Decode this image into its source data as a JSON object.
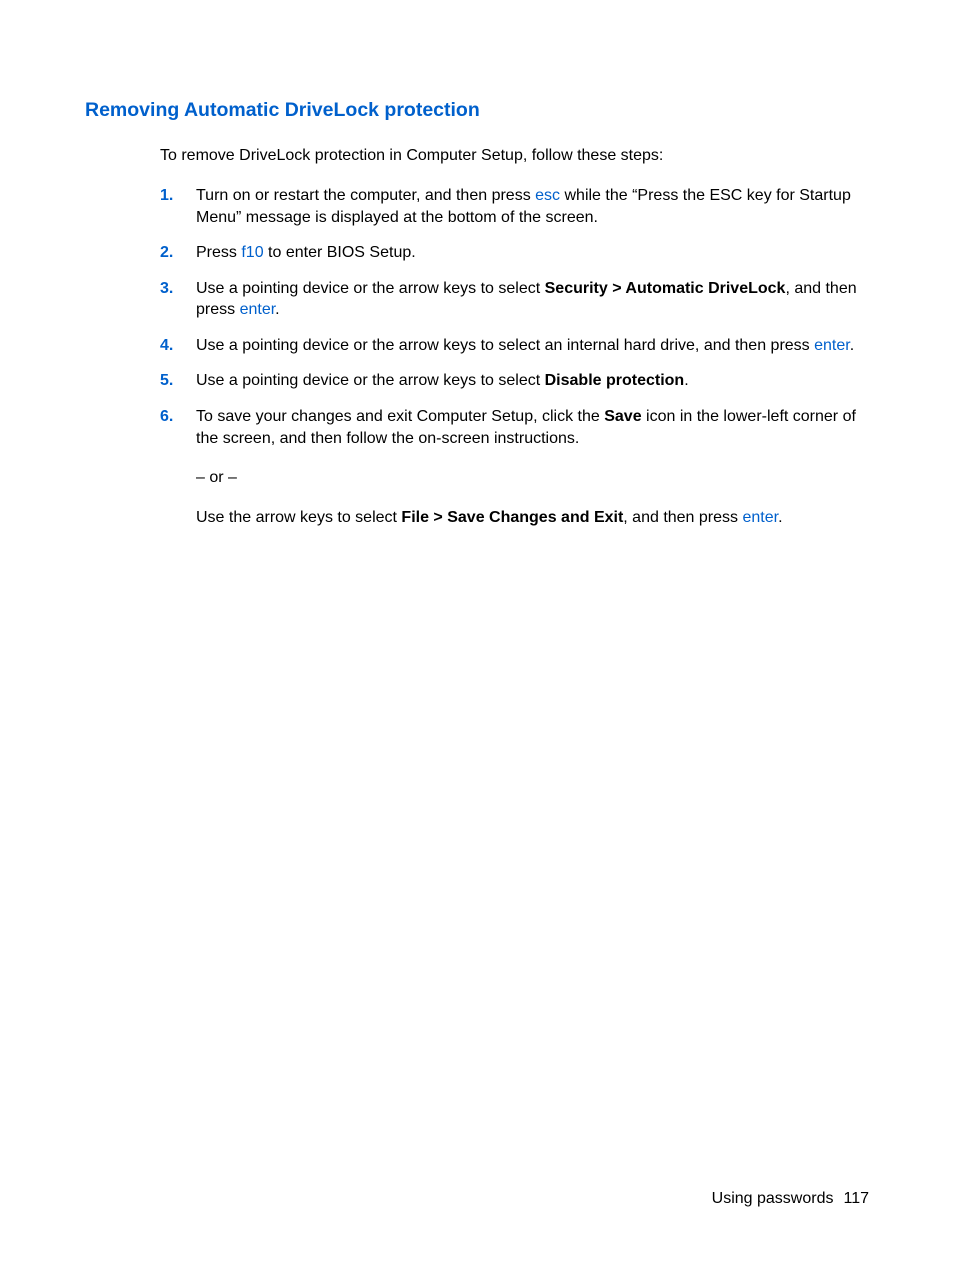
{
  "heading": "Removing Automatic DriveLock protection",
  "intro": "To remove DriveLock protection in Computer Setup, follow these steps:",
  "steps": {
    "s1": {
      "num": "1.",
      "t1": "Turn on or restart the computer, and then press ",
      "k1": "esc",
      "t2": " while the “Press the ESC key for Startup Menu” message is displayed at the bottom of the screen."
    },
    "s2": {
      "num": "2.",
      "t1": "Press ",
      "k1": "f10",
      "t2": " to enter BIOS Setup."
    },
    "s3": {
      "num": "3.",
      "t1": "Use a pointing device or the arrow keys to select ",
      "b1": "Security > Automatic DriveLock",
      "t2": ", and then press ",
      "k1": "enter",
      "t3": "."
    },
    "s4": {
      "num": "4.",
      "t1": "Use a pointing device or the arrow keys to select an internal hard drive, and then press ",
      "k1": "enter",
      "t2": "."
    },
    "s5": {
      "num": "5.",
      "t1": "Use a pointing device or the arrow keys to select ",
      "b1": "Disable protection",
      "t2": "."
    },
    "s6": {
      "num": "6.",
      "p1a": "To save your changes and exit Computer Setup, click the ",
      "p1b": "Save",
      "p1c": " icon in the lower-left corner of the screen, and then follow the on-screen instructions.",
      "p2": "– or –",
      "p3a": "Use the arrow keys to select ",
      "p3b": "File > Save Changes and Exit",
      "p3c": ", and then press ",
      "p3k": "enter",
      "p3d": "."
    }
  },
  "footer": {
    "section": "Using passwords",
    "page": "117"
  }
}
